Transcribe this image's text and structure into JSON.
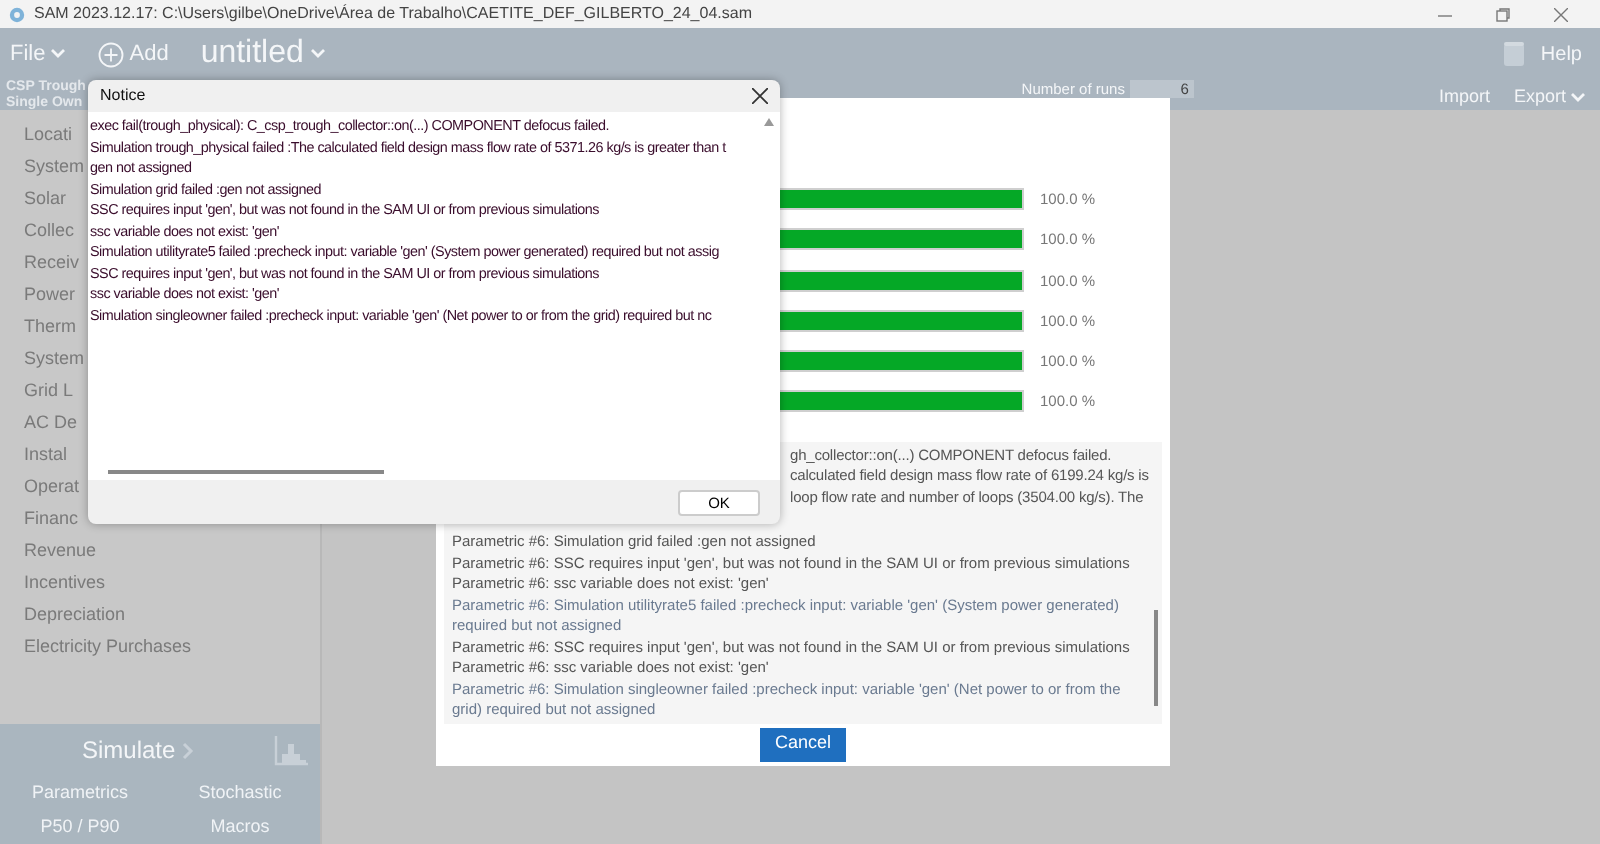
{
  "window": {
    "title": "SAM 2023.12.17: C:\\Users\\gilbe\\OneDrive\\Área de Trabalho\\CAETITE_DEF_GILBERTO_24_04.sam"
  },
  "toolbar": {
    "file_menu": "File",
    "add": "Add",
    "case_tab": "untitled",
    "help": "Help",
    "case_config": [
      "CSP Trough",
      "Single Own"
    ],
    "runs_label": "Number of runs",
    "runs_value": "6",
    "import": "Import",
    "export": "Export"
  },
  "sidebar": {
    "items": [
      "Locati",
      "System",
      "Solar",
      "Collec",
      "Receiv",
      "Power",
      "Therm",
      "System",
      "Grid L",
      "AC De",
      "Instal",
      "Operat",
      "Financ",
      "Revenue",
      "Incentives",
      "Depreciation",
      "Electricity Purchases"
    ]
  },
  "simulate_panel": {
    "simulate": "Simulate",
    "links": [
      "Parametrics",
      "Stochastic",
      "P50 / P90",
      "Macros"
    ]
  },
  "progress_dialog": {
    "bars": [
      {
        "level": 1,
        "reading": "100.0 %"
      },
      {
        "level": 1,
        "reading": "100.0 %"
      },
      {
        "level": 1,
        "reading": "100.0 %"
      },
      {
        "level": 1,
        "reading": "100.0 %"
      },
      {
        "level": 1,
        "reading": "100.0 %"
      },
      {
        "level": 1,
        "reading": "100.0 %"
      }
    ],
    "log": [
      {
        "text": "gh_collector::on(...) COMPONENT defocus failed.",
        "kind": "covered",
        "color": "#555555"
      },
      {
        "text": "calculated field design mass flow rate of 6199.24 kg/s is",
        "kind": "covered",
        "color": "#555555"
      },
      {
        "text": "loop flow rate and number of loops (3504.00 kg/s). The",
        "kind": "covered",
        "color": "#555555"
      },
      {
        "text": "Parametric #6: Simulation grid failed :gen not assigned",
        "kind": "full",
        "color": "#555555"
      },
      {
        "text": "Parametric #6: SSC requires input 'gen', but was not found in the SAM UI or from previous simulations",
        "kind": "full",
        "color": "#555555"
      },
      {
        "text": "Parametric #6: ssc variable does not exist: 'gen'",
        "kind": "full",
        "color": "#555555"
      },
      {
        "text": "Parametric #6: Simulation utilityrate5 failed :precheck input: variable 'gen' (System power generated) required but not assigned",
        "kind": "full",
        "color": "#6a7a90"
      },
      {
        "text": "Parametric #6: SSC requires input 'gen', but was not found in the SAM UI or from previous simulations",
        "kind": "full",
        "color": "#555555"
      },
      {
        "text": "Parametric #6: ssc variable does not exist: 'gen'",
        "kind": "full",
        "color": "#555555"
      },
      {
        "text": "Parametric #6: Simulation singleowner failed :precheck input: variable 'gen' (Net power to or from the grid) required but not assigned",
        "kind": "full",
        "color": "#6a7a90"
      }
    ],
    "cancel": "Cancel"
  },
  "notice": {
    "title": "Notice",
    "lines": [
      "exec fail(trough_physical): C_csp_trough_collector::on(...) COMPONENT defocus failed.",
      "Simulation trough_physical failed :The calculated field design mass flow rate of 5371.26 kg/s is greater than t",
      "gen not assigned",
      "Simulation grid failed :gen not assigned",
      "SSC requires input 'gen', but was not found in the SAM UI or from previous simulations",
      "ssc variable does not exist: 'gen'",
      "Simulation utilityrate5 failed :precheck input: variable 'gen' (System power generated) required but not assig",
      "SSC requires input 'gen', but was not found in the SAM UI or from previous simulations",
      "ssc variable does not exist: 'gen'",
      "Simulation singleowner failed :precheck input: variable 'gen' (Net power to or from the grid) required but nc"
    ],
    "ok": "OK"
  }
}
